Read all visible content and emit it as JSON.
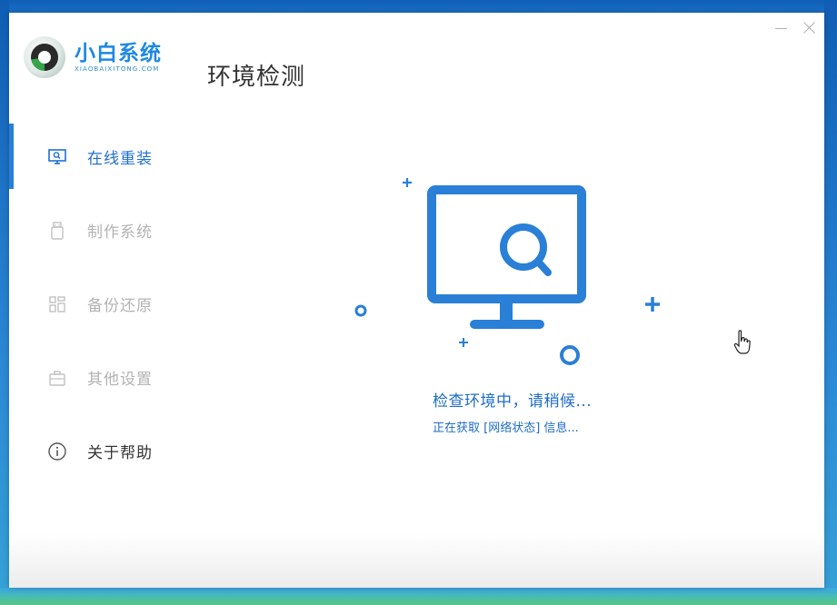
{
  "app": {
    "logo_title": "小白系统",
    "logo_subtitle": "XIAOBAIXITONG.COM",
    "page_title": "环境检测"
  },
  "window_controls": {
    "minimize_icon": "minimize-icon",
    "close_icon": "close-icon"
  },
  "sidebar": {
    "items": [
      {
        "label": "在线重装",
        "icon": "monitor-icon",
        "state": "active"
      },
      {
        "label": "制作系统",
        "icon": "usb-icon",
        "state": "disabled"
      },
      {
        "label": "备份还原",
        "icon": "grid-icon",
        "state": "disabled"
      },
      {
        "label": "其他设置",
        "icon": "briefcase-icon",
        "state": "disabled"
      },
      {
        "label": "关于帮助",
        "icon": "info-icon",
        "state": "normal"
      }
    ]
  },
  "main": {
    "status_text": "检查环境中，请稍候...",
    "status_detail": "正在获取 [网络状态] 信息..."
  },
  "colors": {
    "accent": "#2a7fd7",
    "text_active": "#1e6fd0",
    "text_disabled": "#b3b3b3",
    "desktop": "#2a86d8"
  }
}
